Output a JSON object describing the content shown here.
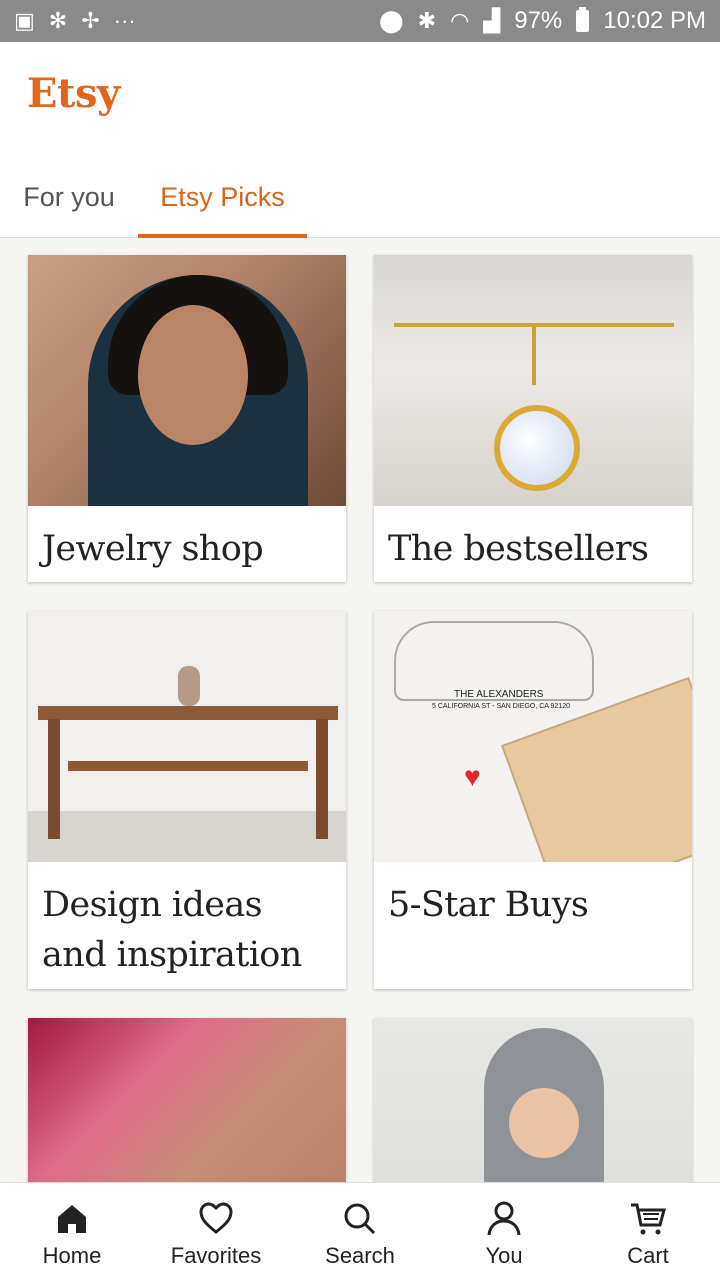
{
  "status_bar": {
    "left_icons": [
      "image-icon",
      "pinwheel-icon",
      "pinwheel-outline-icon",
      "more-dots-icon"
    ],
    "right_icons": [
      "location-icon",
      "bluetooth-icon",
      "wifi-icon",
      "signal-icon",
      "battery-icon"
    ],
    "battery": "97%",
    "time": "10:02 PM"
  },
  "header": {
    "logo": "Etsy",
    "tabs": [
      {
        "label": "For you",
        "selected": false
      },
      {
        "label": "Etsy Picks",
        "selected": true
      }
    ]
  },
  "cards": [
    {
      "title": "Jewelry shop"
    },
    {
      "title": "The bestsellers"
    },
    {
      "title": "Design ideas and inspiration"
    },
    {
      "title": "5-Star Buys"
    },
    {
      "title": ""
    },
    {
      "title": ""
    }
  ],
  "stamp_text": {
    "line1": "THE ALEXANDERS",
    "line2": "5 CALIFORNIA ST - SAN DIEGO, CA 92120"
  },
  "bottom_nav": [
    {
      "label": "Home",
      "icon": "home-icon",
      "active": true
    },
    {
      "label": "Favorites",
      "icon": "heart-icon",
      "active": false
    },
    {
      "label": "Search",
      "icon": "search-icon",
      "active": false
    },
    {
      "label": "You",
      "icon": "person-icon",
      "active": false
    },
    {
      "label": "Cart",
      "icon": "cart-icon",
      "active": false
    }
  ],
  "colors": {
    "accent": "#e2651b",
    "status_bar": "#8a8a8a",
    "background": "#f5f5f1"
  }
}
